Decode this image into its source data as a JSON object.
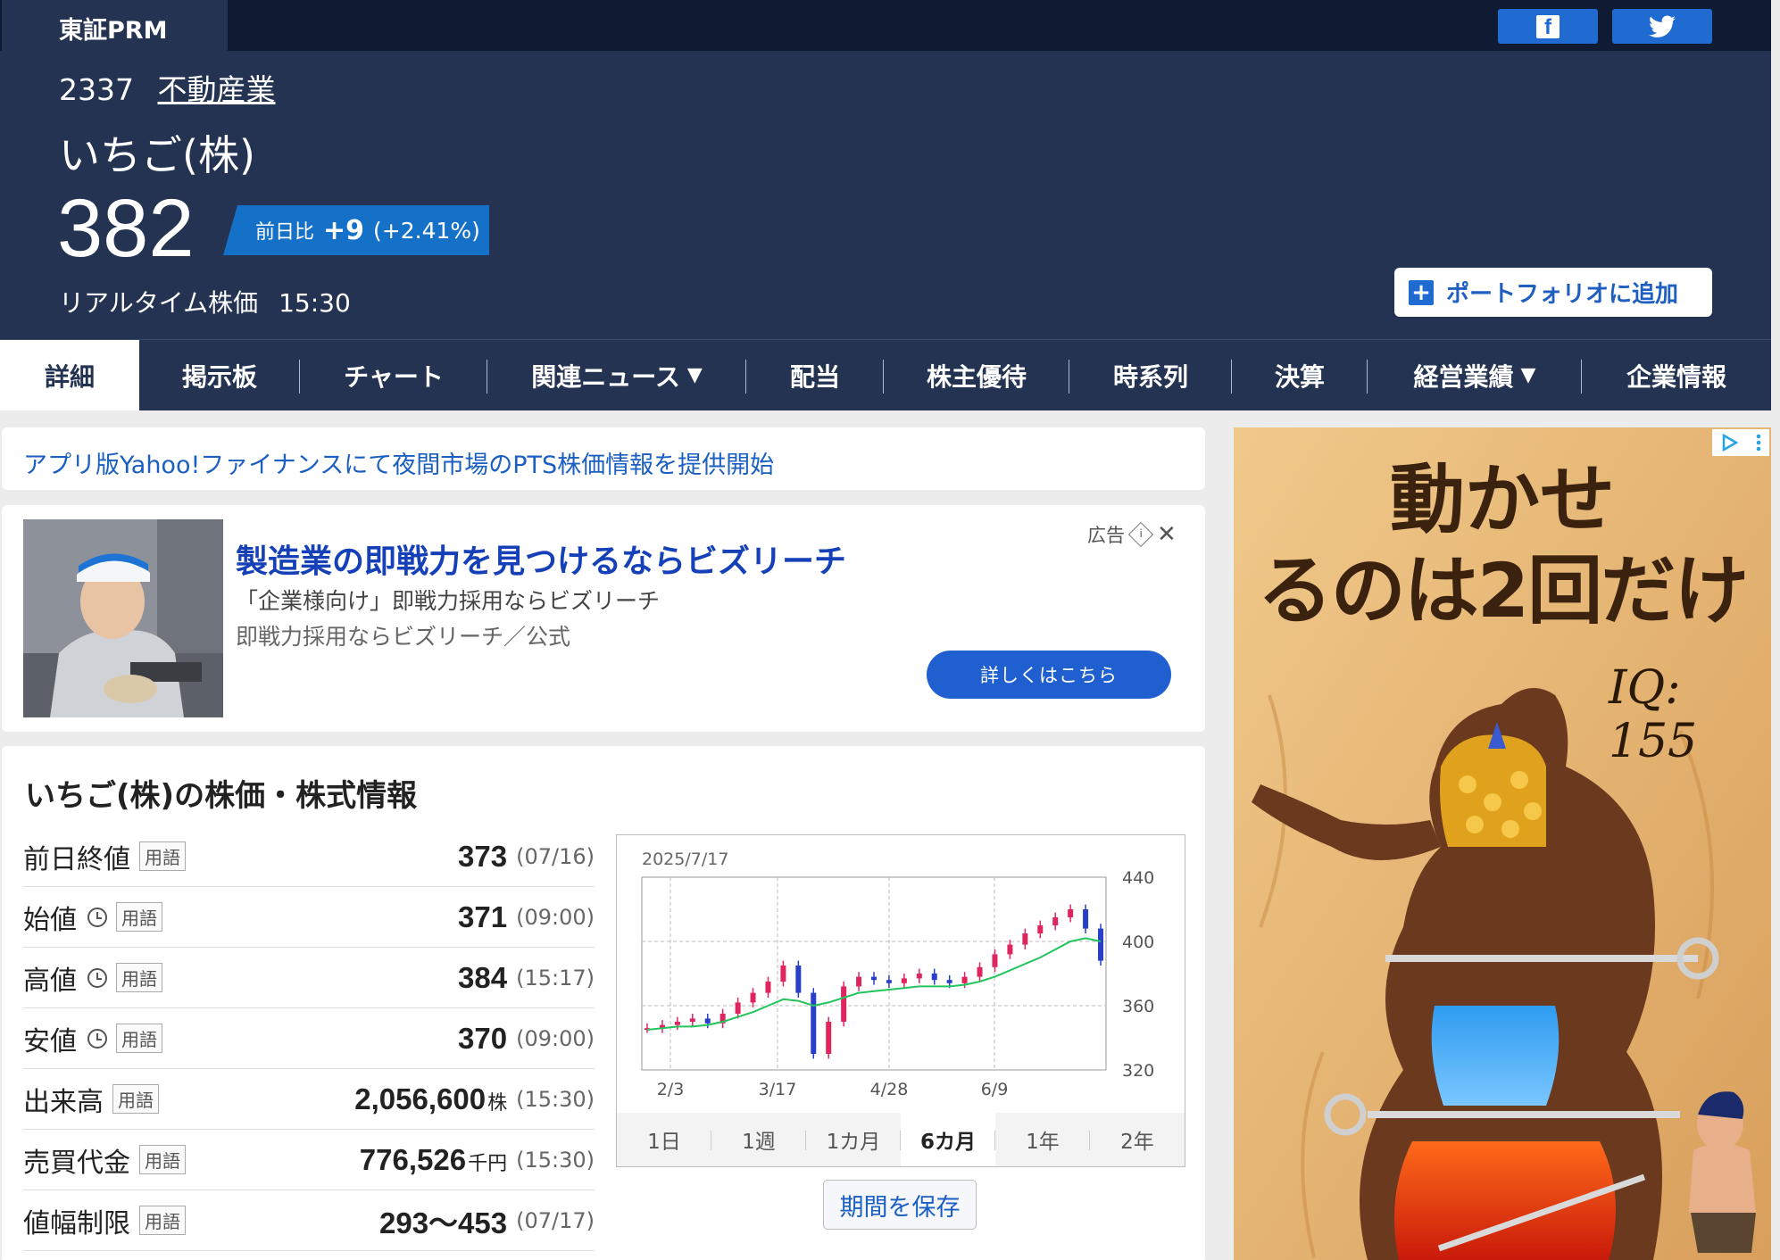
{
  "header": {
    "market": "東証PRM",
    "code": "2337",
    "industry": "不動産業",
    "company": "いちご(株)",
    "price": "382",
    "change_label": "前日比",
    "change_amount": "+9",
    "change_pct": "(+2.41%)",
    "realtime_label": "リアルタイム株価",
    "realtime_time": "15:30",
    "portfolio_button": "ポートフォリオに追加",
    "share_facebook": "facebook-icon",
    "share_twitter": "twitter-icon"
  },
  "nav": {
    "items": [
      {
        "label": "詳細",
        "active": true
      },
      {
        "label": "掲示板"
      },
      {
        "label": "チャート"
      },
      {
        "label": "関連ニュース",
        "caret": "▼"
      },
      {
        "label": "配当"
      },
      {
        "label": "株主優待"
      },
      {
        "label": "時系列"
      },
      {
        "label": "決算"
      },
      {
        "label": "経営業績",
        "caret": "▼"
      },
      {
        "label": "企業情報"
      }
    ]
  },
  "notice": {
    "text": "アプリ版Yahoo!ファイナンスにて夜間市場のPTS株価情報を提供開始"
  },
  "ad": {
    "title": "製造業の即戦力を見つけるならビズリーチ",
    "description": "「企業様向け」即戦力採用ならビズリーチ",
    "source": "即戦力採用ならビズリーチ／公式",
    "label": "広告",
    "cta": "詳しくはこちら"
  },
  "stock_info": {
    "title": "いちご(株)の株価・株式情報",
    "term_tag": "用語",
    "rows": [
      {
        "label": "前日終値",
        "value": "373",
        "unit": "",
        "time": "(07/16)",
        "clock": false
      },
      {
        "label": "始値",
        "value": "371",
        "unit": "",
        "time": "(09:00)",
        "clock": true
      },
      {
        "label": "高値",
        "value": "384",
        "unit": "",
        "time": "(15:17)",
        "clock": true
      },
      {
        "label": "安値",
        "value": "370",
        "unit": "",
        "time": "(09:00)",
        "clock": true
      },
      {
        "label": "出来高",
        "value": "2,056,600",
        "unit": "株",
        "time": "(15:30)",
        "clock": false
      },
      {
        "label": "売買代金",
        "value": "776,526",
        "unit": "千円",
        "time": "(15:30)",
        "clock": false
      },
      {
        "label": "値幅制限",
        "value": "293〜453",
        "unit": "",
        "time": "(07/17)",
        "clock": false
      }
    ]
  },
  "chart": {
    "date": "2025/7/17",
    "x_ticks": [
      "2/3",
      "3/17",
      "4/28",
      "6/9"
    ],
    "y_ticks": [
      "440",
      "400",
      "360",
      "320"
    ],
    "periods": [
      "1日",
      "1週",
      "1カ月",
      "6カ月",
      "1年",
      "2年"
    ],
    "active_period": "6カ月",
    "save_button": "期間を保存",
    "colors": {
      "up": "#e0245e",
      "down": "#2a3fc8",
      "ma": "#22c55e",
      "ma_short": "#a855f7"
    }
  },
  "chart_data": {
    "type": "line",
    "title": "",
    "xlabel": "",
    "ylabel": "",
    "x_ticks": [
      "2/3",
      "3/17",
      "4/28",
      "6/9"
    ],
    "ylim": [
      320,
      440
    ],
    "series": [
      {
        "values": [
          346,
          348,
          350,
          352,
          349,
          355,
          362,
          368,
          375,
          385,
          368,
          330,
          350,
          372,
          378,
          376,
          374,
          377,
          380,
          376,
          374,
          378,
          384,
          392,
          398,
          405,
          410,
          415,
          420,
          408,
          388
        ]
      },
      {
        "values": [
          345,
          346,
          347,
          347,
          348,
          350,
          353,
          356,
          360,
          364,
          363,
          360,
          362,
          365,
          368,
          369,
          370,
          371,
          372,
          372,
          372,
          373,
          375,
          378,
          382,
          386,
          390,
          395,
          400,
          402,
          400
        ]
      }
    ]
  },
  "side_ad": {
    "headline1": "動かせ",
    "headline2": "るのは2回だけ",
    "iq": "IQ: 155"
  }
}
